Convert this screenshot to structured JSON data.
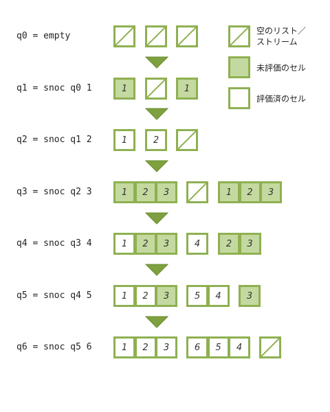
{
  "colors": {
    "border": "#8fb050",
    "unevaluated_fill": "#c3d99f",
    "evaluated_fill": "#ffffff",
    "arrow_fill": "#7fa03e"
  },
  "legend": {
    "empty_stream": "空のリスト／\nストリーム",
    "unevaluated_cell": "未評価のセル",
    "evaluated_cell": "評価済のセル"
  },
  "rows": [
    {
      "label": "q0 = empty",
      "groups": [
        [
          {
            "kind": "empty"
          }
        ],
        [
          {
            "kind": "empty"
          }
        ],
        [
          {
            "kind": "empty"
          }
        ]
      ]
    },
    {
      "label": "q1 = snoc q0 1",
      "groups": [
        [
          {
            "kind": "unevaluated",
            "value": "1"
          }
        ],
        [
          {
            "kind": "empty"
          }
        ],
        [
          {
            "kind": "unevaluated",
            "value": "1"
          }
        ]
      ]
    },
    {
      "label": "q2 = snoc q1 2",
      "groups": [
        [
          {
            "kind": "evaluated",
            "value": "1"
          }
        ],
        [
          {
            "kind": "evaluated",
            "value": "2"
          }
        ],
        [
          {
            "kind": "empty"
          }
        ]
      ]
    },
    {
      "label": "q3 = snoc q2 3",
      "groups": [
        [
          {
            "kind": "unevaluated",
            "value": "1"
          },
          {
            "kind": "unevaluated",
            "value": "2"
          },
          {
            "kind": "unevaluated",
            "value": "3"
          }
        ],
        [
          {
            "kind": "empty"
          }
        ],
        [
          {
            "kind": "unevaluated",
            "value": "1"
          },
          {
            "kind": "unevaluated",
            "value": "2"
          },
          {
            "kind": "unevaluated",
            "value": "3"
          }
        ]
      ]
    },
    {
      "label": "q4 = snoc q3 4",
      "groups": [
        [
          {
            "kind": "evaluated",
            "value": "1"
          },
          {
            "kind": "unevaluated",
            "value": "2"
          },
          {
            "kind": "unevaluated",
            "value": "3"
          }
        ],
        [
          {
            "kind": "evaluated",
            "value": "4"
          }
        ],
        [
          {
            "kind": "unevaluated",
            "value": "2"
          },
          {
            "kind": "unevaluated",
            "value": "3"
          }
        ]
      ]
    },
    {
      "label": "q5 = snoc q4 5",
      "groups": [
        [
          {
            "kind": "evaluated",
            "value": "1"
          },
          {
            "kind": "evaluated",
            "value": "2"
          },
          {
            "kind": "unevaluated",
            "value": "3"
          }
        ],
        [
          {
            "kind": "evaluated",
            "value": "5"
          },
          {
            "kind": "evaluated",
            "value": "4"
          }
        ],
        [
          {
            "kind": "unevaluated",
            "value": "3"
          }
        ]
      ]
    },
    {
      "label": "q6 = snoc q5 6",
      "groups": [
        [
          {
            "kind": "evaluated",
            "value": "1"
          },
          {
            "kind": "evaluated",
            "value": "2"
          },
          {
            "kind": "evaluated",
            "value": "3"
          }
        ],
        [
          {
            "kind": "evaluated",
            "value": "6"
          },
          {
            "kind": "evaluated",
            "value": "5"
          },
          {
            "kind": "evaluated",
            "value": "4"
          }
        ],
        [
          {
            "kind": "empty"
          }
        ]
      ]
    }
  ]
}
